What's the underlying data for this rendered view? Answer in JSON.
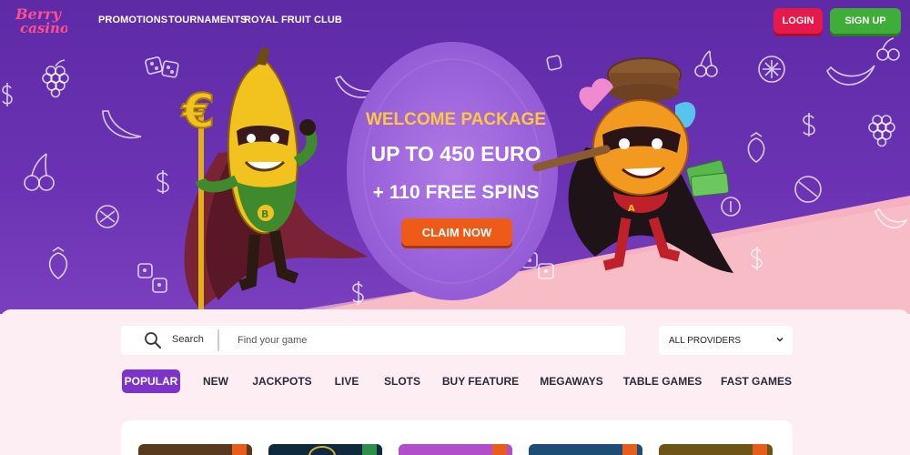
{
  "brand": {
    "name": "Berry casino",
    "logo_color": "#ff4f8f"
  },
  "nav": {
    "items": [
      {
        "label": "PROMOTIONS"
      },
      {
        "label": "TOURNAMENTS"
      },
      {
        "label": "ROYAL FRUIT CLUB"
      }
    ],
    "login_label": "LOGIN",
    "signup_label": "SIGN UP"
  },
  "promo": {
    "title": "WELCOME PACKAGE",
    "amount": "UP TO 450 EURO",
    "spins": "+ 110 FREE SPINS",
    "cta_label": "CLAIM NOW"
  },
  "search": {
    "label": "Search",
    "placeholder": "Find your game",
    "value": ""
  },
  "providers": {
    "selected": "ALL PROVIDERS",
    "icon": "chevron-down-icon"
  },
  "categories": [
    {
      "label": "POPULAR",
      "active": true
    },
    {
      "label": "NEW",
      "active": false
    },
    {
      "label": "JACKPOTS",
      "active": false
    },
    {
      "label": "LIVE",
      "active": false
    },
    {
      "label": "SLOTS",
      "active": false
    },
    {
      "label": "BUY FEATURE",
      "active": false
    },
    {
      "label": "MEGAWAYS",
      "active": false
    },
    {
      "label": "TABLE GAMES",
      "active": false
    },
    {
      "label": "FAST GAMES",
      "active": false
    }
  ],
  "games": [
    {
      "icon": "game-thumbnail-1",
      "color": "#5a3a1e",
      "badge_color": "#e85d1a"
    },
    {
      "icon": "game-thumbnail-2",
      "color": "#0f2a3c",
      "badge_color": "#2c8f4a"
    },
    {
      "icon": "game-thumbnail-3",
      "color": "#b04fc9",
      "badge_color": "#e85d1a"
    },
    {
      "icon": "game-thumbnail-4",
      "color": "#1d4c74",
      "badge_color": "#e85d1a"
    },
    {
      "icon": "game-thumbnail-5",
      "color": "#6e5416",
      "badge_color": "#e85d1a"
    }
  ],
  "colors": {
    "hero_purple": "#6b33b3",
    "accent_pink": "#ff4f8f",
    "promo_yellow": "#ffc640",
    "cta_orange": "#ee5a17",
    "login_red": "#e6194b",
    "signup_green": "#3fae38",
    "tab_active": "#7b33c9"
  }
}
